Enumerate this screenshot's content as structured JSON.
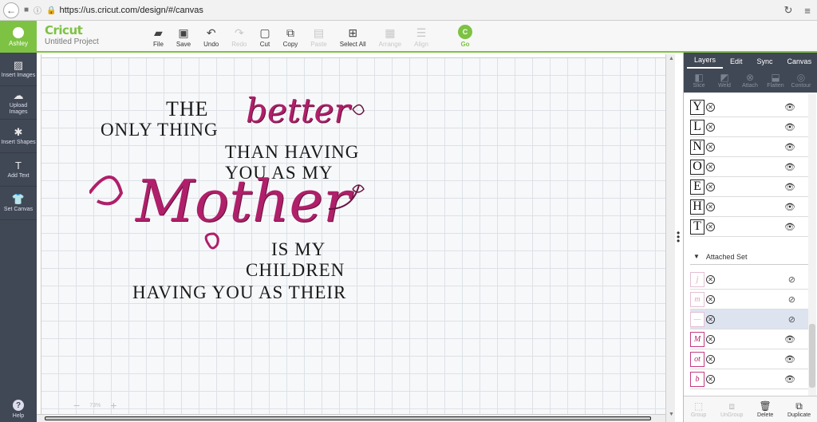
{
  "browser": {
    "url": "https://us.cricut.com/design/#/canvas"
  },
  "header": {
    "user_name": "Ashley",
    "brand": "Cricut",
    "project_title": "Untitled Project",
    "tools": [
      {
        "label": "File",
        "icon": "folder-icon",
        "disabled": false
      },
      {
        "label": "Save",
        "icon": "save-icon",
        "disabled": false
      },
      {
        "label": "Undo",
        "icon": "undo-icon",
        "disabled": false
      },
      {
        "label": "Redo",
        "icon": "redo-icon",
        "disabled": true
      },
      {
        "label": "Cut",
        "icon": "cut-icon",
        "disabled": false
      },
      {
        "label": "Copy",
        "icon": "copy-icon",
        "disabled": false
      },
      {
        "label": "Paste",
        "icon": "paste-icon",
        "disabled": true
      },
      {
        "label": "Select All",
        "icon": "select-all-icon",
        "disabled": false
      },
      {
        "label": "Arrange",
        "icon": "arrange-icon",
        "disabled": true
      },
      {
        "label": "Align",
        "icon": "align-icon",
        "disabled": true
      }
    ],
    "go_badge": "C",
    "go_label": "Go"
  },
  "sidebar": {
    "items": [
      {
        "label": "Insert Images",
        "icon": "image-icon"
      },
      {
        "label": "Upload Images",
        "icon": "upload-icon"
      },
      {
        "label": "Insert Shapes",
        "icon": "shapes-icon"
      },
      {
        "label": "Add Text",
        "icon": "text-icon"
      },
      {
        "label": "Set Canvas",
        "icon": "shirt-icon"
      }
    ],
    "help_label": "Help"
  },
  "canvas": {
    "zoom": "73%",
    "design_lines": {
      "l1": "THE",
      "l2": "ONLY THING",
      "better": "better",
      "l3": "THAN HAVING",
      "l4": "YOU AS MY",
      "mother": "Mother",
      "l5": "IS MY",
      "l6": "CHILDREN",
      "l7": "HAVING YOU AS THEIR"
    }
  },
  "panel": {
    "tabs": [
      "Layers",
      "Edit",
      "Sync",
      "Canvas"
    ],
    "tools": [
      {
        "label": "Slice"
      },
      {
        "label": "Weld"
      },
      {
        "label": "Attach"
      },
      {
        "label": "Flatten"
      },
      {
        "label": "Contour"
      }
    ],
    "layers": [
      {
        "glyph": "Y"
      },
      {
        "glyph": "L"
      },
      {
        "glyph": "N"
      },
      {
        "glyph": "O"
      },
      {
        "glyph": "E"
      },
      {
        "glyph": "H"
      },
      {
        "glyph": "T"
      }
    ],
    "attached_set_label": "Attached Set",
    "attached_layers": [
      {
        "glyph": "j",
        "visible": false
      },
      {
        "glyph": "m",
        "visible": false
      },
      {
        "glyph": "—",
        "visible": false
      },
      {
        "glyph": "M",
        "visible": true
      },
      {
        "glyph": "ot",
        "visible": true
      },
      {
        "glyph": "b",
        "visible": true
      }
    ],
    "footer": [
      {
        "label": "Group",
        "disabled": true
      },
      {
        "label": "UnGroup",
        "disabled": true
      },
      {
        "label": "Delete",
        "disabled": false
      },
      {
        "label": "Duplicate",
        "disabled": false
      }
    ]
  }
}
